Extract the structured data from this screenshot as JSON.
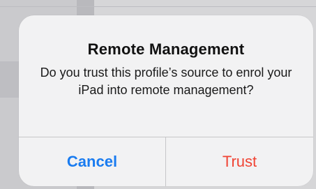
{
  "alert": {
    "title": "Remote Management",
    "message": "Do you trust this profile’s source to enrol your iPad into remote management?",
    "buttons": {
      "cancel_label": "Cancel",
      "trust_label": "Trust"
    }
  },
  "colors": {
    "cancel": "#1a7cf0",
    "destructive": "#f04434",
    "alert_background": "#f2f2f3"
  }
}
